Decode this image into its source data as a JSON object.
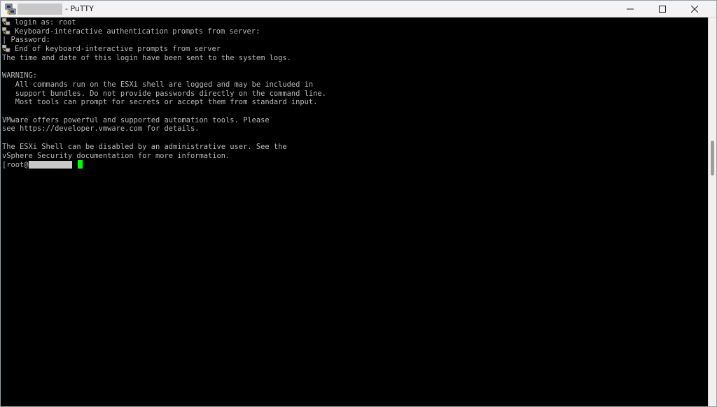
{
  "window": {
    "title": "- PuTTY"
  },
  "icons": {
    "app": "putty-icon",
    "key": "key-icon",
    "minimize": "minimize-icon",
    "maximize": "maximize-icon",
    "close": "close-icon"
  },
  "colors": {
    "terminal_bg": "#000000",
    "terminal_fg": "#bbbbbb",
    "cursor": "#00ff00",
    "titlebar_bg": "#f3f3f3"
  },
  "terminal": {
    "lines": [
      "login as: root",
      "Keyboard-interactive authentication prompts from server:",
      "| Password:",
      "End of keyboard-interactive prompts from server",
      "The time and date of this login have been sent to the system logs.",
      "",
      "WARNING:",
      "   All commands run on the ESXi shell are logged and may be included in",
      "   support bundles. Do not provide passwords directly on the command line.",
      "   Most tools can prompt for secrets or accept them from standard input.",
      "",
      "VMware offers powerful and supported automation tools. Please",
      "see https://developer.vmware.com for details.",
      "",
      "The ESXi Shell can be disabled by an administrative user. See the",
      "vSphere Security documentation for more information."
    ],
    "prompt_prefix": "[root@"
  }
}
